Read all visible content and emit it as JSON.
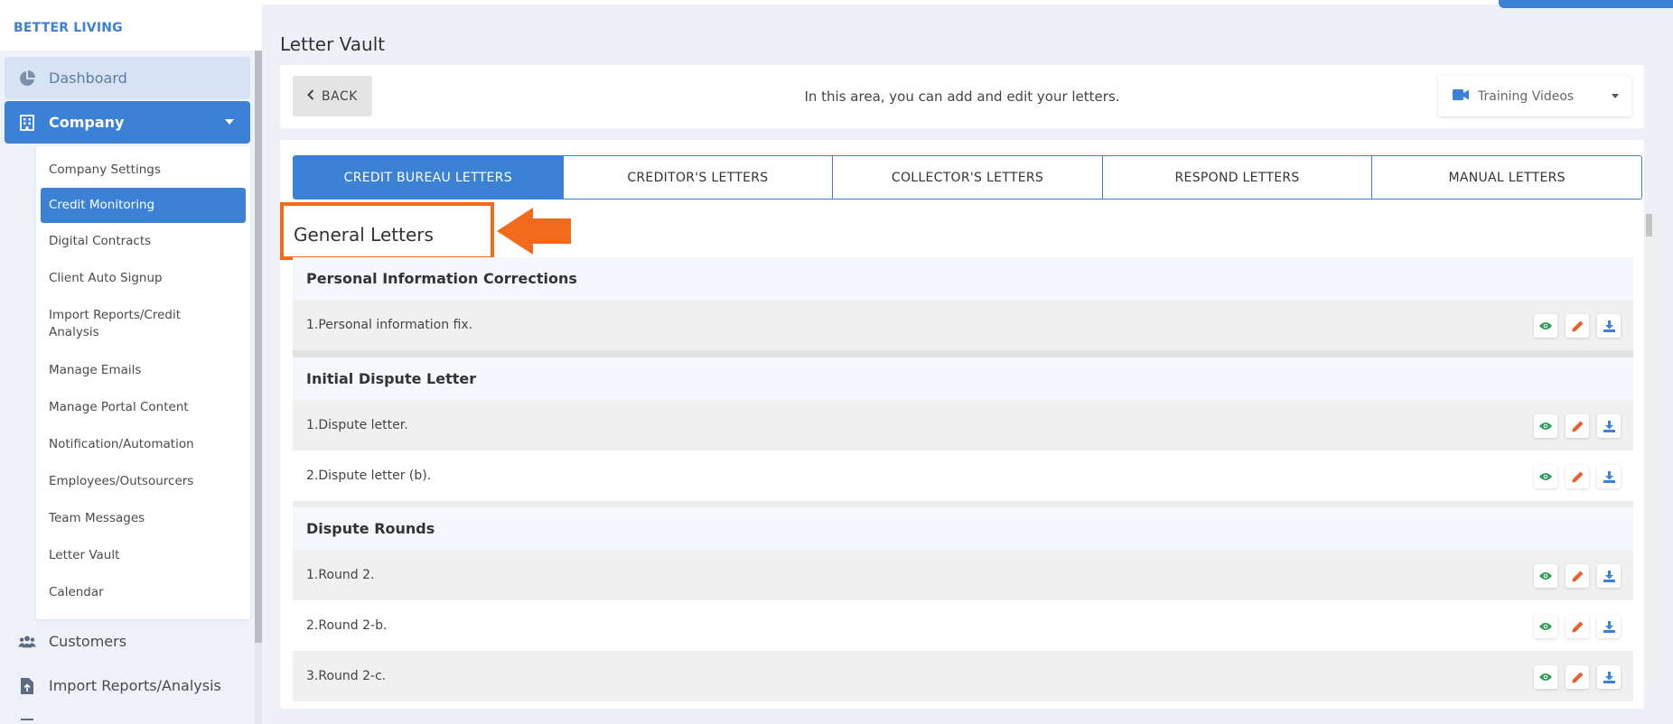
{
  "brand": "BETTER LIVING",
  "sidebar": {
    "items": [
      {
        "label": "Dashboard"
      },
      {
        "label": "Company"
      },
      {
        "label": "Customers"
      },
      {
        "label": "Import Reports/Analysis"
      }
    ],
    "submenu": [
      {
        "label": "Company Settings"
      },
      {
        "label": "Credit Monitoring"
      },
      {
        "label": "Digital Contracts"
      },
      {
        "label": "Client Auto Signup"
      },
      {
        "label": "Import Reports/Credit Analysis"
      },
      {
        "label": "Manage Emails"
      },
      {
        "label": "Manage Portal Content"
      },
      {
        "label": "Notification/Automation"
      },
      {
        "label": "Employees/Outsourcers"
      },
      {
        "label": "Team Messages"
      },
      {
        "label": "Letter Vault"
      },
      {
        "label": "Calendar"
      }
    ]
  },
  "page": {
    "title": "Letter Vault",
    "back_label": "BACK",
    "info": "In this area, you can add and edit your letters.",
    "training_label": "Training Videos"
  },
  "tabs": [
    {
      "label": "CREDIT BUREAU LETTERS"
    },
    {
      "label": "CREDITOR'S LETTERS"
    },
    {
      "label": "COLLECTOR'S LETTERS"
    },
    {
      "label": "RESPOND LETTERS"
    },
    {
      "label": "MANUAL LETTERS"
    }
  ],
  "section_title": "General Letters",
  "groups": [
    {
      "title": "Personal Information Corrections",
      "letters": [
        "1.Personal information fix."
      ]
    },
    {
      "title": "Initial Dispute Letter",
      "letters": [
        "1.Dispute letter.",
        "2.Dispute letter (b)."
      ]
    },
    {
      "title": "Dispute Rounds",
      "letters": [
        "1.Round 2.",
        "2.Round 2-b.",
        "3.Round 2-c."
      ]
    }
  ],
  "icons": {
    "view": "eye-icon",
    "edit": "pencil-icon",
    "download": "download-icon"
  },
  "colors": {
    "primary": "#3b82d6",
    "highlight": "#f26b1d",
    "view": "#2e9e55",
    "edit": "#e8612c",
    "download": "#3b82d6"
  }
}
